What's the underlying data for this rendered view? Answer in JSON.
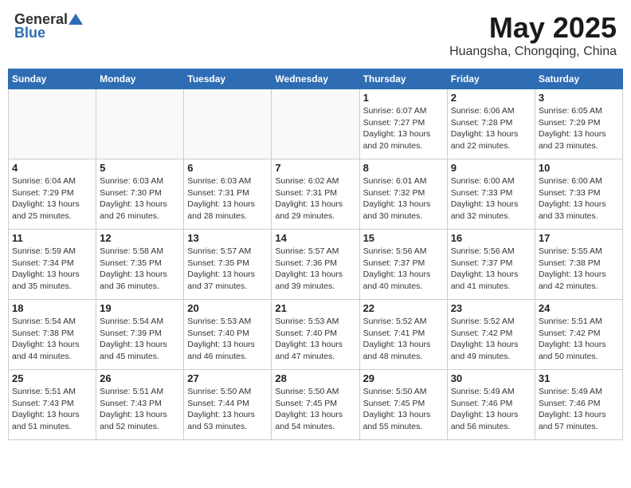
{
  "header": {
    "logo_general": "General",
    "logo_blue": "Blue",
    "main_title": "May 2025",
    "subtitle": "Huangsha, Chongqing, China"
  },
  "days_of_week": [
    "Sunday",
    "Monday",
    "Tuesday",
    "Wednesday",
    "Thursday",
    "Friday",
    "Saturday"
  ],
  "weeks": [
    [
      {
        "day": "",
        "detail": ""
      },
      {
        "day": "",
        "detail": ""
      },
      {
        "day": "",
        "detail": ""
      },
      {
        "day": "",
        "detail": ""
      },
      {
        "day": "1",
        "detail": "Sunrise: 6:07 AM\nSunset: 7:27 PM\nDaylight: 13 hours\nand 20 minutes."
      },
      {
        "day": "2",
        "detail": "Sunrise: 6:06 AM\nSunset: 7:28 PM\nDaylight: 13 hours\nand 22 minutes."
      },
      {
        "day": "3",
        "detail": "Sunrise: 6:05 AM\nSunset: 7:29 PM\nDaylight: 13 hours\nand 23 minutes."
      }
    ],
    [
      {
        "day": "4",
        "detail": "Sunrise: 6:04 AM\nSunset: 7:29 PM\nDaylight: 13 hours\nand 25 minutes."
      },
      {
        "day": "5",
        "detail": "Sunrise: 6:03 AM\nSunset: 7:30 PM\nDaylight: 13 hours\nand 26 minutes."
      },
      {
        "day": "6",
        "detail": "Sunrise: 6:03 AM\nSunset: 7:31 PM\nDaylight: 13 hours\nand 28 minutes."
      },
      {
        "day": "7",
        "detail": "Sunrise: 6:02 AM\nSunset: 7:31 PM\nDaylight: 13 hours\nand 29 minutes."
      },
      {
        "day": "8",
        "detail": "Sunrise: 6:01 AM\nSunset: 7:32 PM\nDaylight: 13 hours\nand 30 minutes."
      },
      {
        "day": "9",
        "detail": "Sunrise: 6:00 AM\nSunset: 7:33 PM\nDaylight: 13 hours\nand 32 minutes."
      },
      {
        "day": "10",
        "detail": "Sunrise: 6:00 AM\nSunset: 7:33 PM\nDaylight: 13 hours\nand 33 minutes."
      }
    ],
    [
      {
        "day": "11",
        "detail": "Sunrise: 5:59 AM\nSunset: 7:34 PM\nDaylight: 13 hours\nand 35 minutes."
      },
      {
        "day": "12",
        "detail": "Sunrise: 5:58 AM\nSunset: 7:35 PM\nDaylight: 13 hours\nand 36 minutes."
      },
      {
        "day": "13",
        "detail": "Sunrise: 5:57 AM\nSunset: 7:35 PM\nDaylight: 13 hours\nand 37 minutes."
      },
      {
        "day": "14",
        "detail": "Sunrise: 5:57 AM\nSunset: 7:36 PM\nDaylight: 13 hours\nand 39 minutes."
      },
      {
        "day": "15",
        "detail": "Sunrise: 5:56 AM\nSunset: 7:37 PM\nDaylight: 13 hours\nand 40 minutes."
      },
      {
        "day": "16",
        "detail": "Sunrise: 5:56 AM\nSunset: 7:37 PM\nDaylight: 13 hours\nand 41 minutes."
      },
      {
        "day": "17",
        "detail": "Sunrise: 5:55 AM\nSunset: 7:38 PM\nDaylight: 13 hours\nand 42 minutes."
      }
    ],
    [
      {
        "day": "18",
        "detail": "Sunrise: 5:54 AM\nSunset: 7:38 PM\nDaylight: 13 hours\nand 44 minutes."
      },
      {
        "day": "19",
        "detail": "Sunrise: 5:54 AM\nSunset: 7:39 PM\nDaylight: 13 hours\nand 45 minutes."
      },
      {
        "day": "20",
        "detail": "Sunrise: 5:53 AM\nSunset: 7:40 PM\nDaylight: 13 hours\nand 46 minutes."
      },
      {
        "day": "21",
        "detail": "Sunrise: 5:53 AM\nSunset: 7:40 PM\nDaylight: 13 hours\nand 47 minutes."
      },
      {
        "day": "22",
        "detail": "Sunrise: 5:52 AM\nSunset: 7:41 PM\nDaylight: 13 hours\nand 48 minutes."
      },
      {
        "day": "23",
        "detail": "Sunrise: 5:52 AM\nSunset: 7:42 PM\nDaylight: 13 hours\nand 49 minutes."
      },
      {
        "day": "24",
        "detail": "Sunrise: 5:51 AM\nSunset: 7:42 PM\nDaylight: 13 hours\nand 50 minutes."
      }
    ],
    [
      {
        "day": "25",
        "detail": "Sunrise: 5:51 AM\nSunset: 7:43 PM\nDaylight: 13 hours\nand 51 minutes."
      },
      {
        "day": "26",
        "detail": "Sunrise: 5:51 AM\nSunset: 7:43 PM\nDaylight: 13 hours\nand 52 minutes."
      },
      {
        "day": "27",
        "detail": "Sunrise: 5:50 AM\nSunset: 7:44 PM\nDaylight: 13 hours\nand 53 minutes."
      },
      {
        "day": "28",
        "detail": "Sunrise: 5:50 AM\nSunset: 7:45 PM\nDaylight: 13 hours\nand 54 minutes."
      },
      {
        "day": "29",
        "detail": "Sunrise: 5:50 AM\nSunset: 7:45 PM\nDaylight: 13 hours\nand 55 minutes."
      },
      {
        "day": "30",
        "detail": "Sunrise: 5:49 AM\nSunset: 7:46 PM\nDaylight: 13 hours\nand 56 minutes."
      },
      {
        "day": "31",
        "detail": "Sunrise: 5:49 AM\nSunset: 7:46 PM\nDaylight: 13 hours\nand 57 minutes."
      }
    ]
  ]
}
